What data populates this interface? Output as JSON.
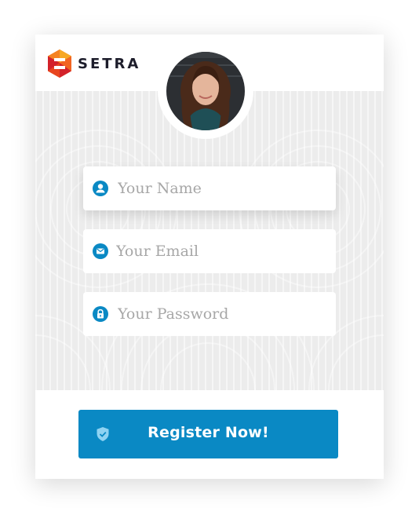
{
  "brand": {
    "name": "SETRA",
    "colors": {
      "logo_orange": "#f26522",
      "logo_red": "#d3222a",
      "logo_yellow": "#f7a823",
      "text": "#1d1d2b"
    }
  },
  "avatar": {
    "icon": "user-photo"
  },
  "form": {
    "name": {
      "placeholder": "Your Name",
      "icon": "user-icon"
    },
    "email": {
      "placeholder": "Your Email",
      "icon": "envelope-icon"
    },
    "password": {
      "placeholder": "Your Password",
      "icon": "lock-icon"
    }
  },
  "register": {
    "label": "Register Now!",
    "icon": "shield-check-icon"
  },
  "colors": {
    "accent": "#0a89c4",
    "background_pattern": "#ececec",
    "placeholder": "#a7a7a7"
  }
}
